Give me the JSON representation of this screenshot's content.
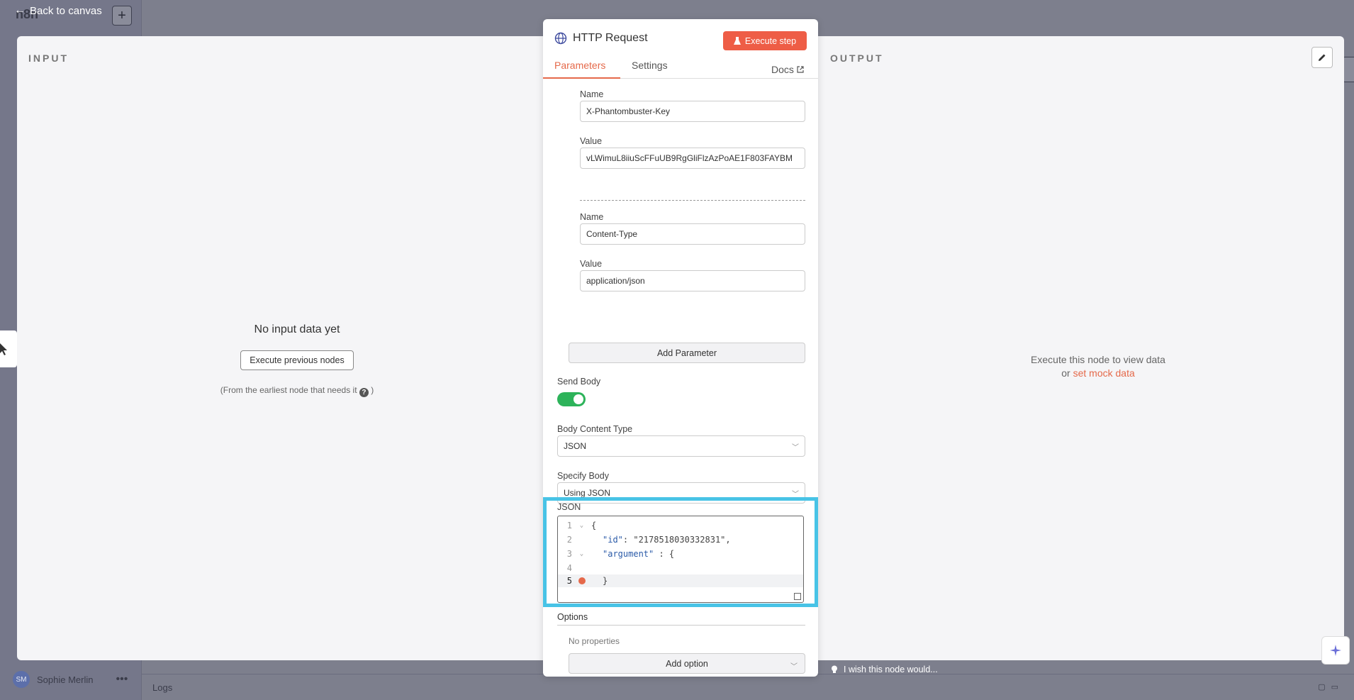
{
  "background": {
    "app_logo": "n8n",
    "user_initials": "SM",
    "user_name": "Sophie Merlin",
    "logs_label": "Logs"
  },
  "back_to_canvas": "Back to canvas",
  "input_pane": {
    "title": "INPUT",
    "empty_heading": "No input data yet",
    "execute_previous_label": "Execute previous nodes",
    "hint_prefix": "(From the earliest node that needs it",
    "hint_suffix": ")"
  },
  "output_pane": {
    "title": "OUTPUT",
    "message_line1": "Execute this node to view data",
    "message_or": "or",
    "mock_link": "set mock data"
  },
  "node": {
    "title": "HTTP Request",
    "execute_label": "Execute step",
    "tabs": {
      "parameters": "Parameters",
      "settings": "Settings",
      "docs": "Docs"
    },
    "headers": [
      {
        "name_label": "Name",
        "name_value": "X-Phantombuster-Key",
        "value_label": "Value",
        "value_value": "vLWimuL8iiuScFFuUB9RgGliFlzAzPoAE1F803FAYBM"
      },
      {
        "name_label": "Name",
        "name_value": "Content-Type",
        "value_label": "Value",
        "value_value": "application/json"
      }
    ],
    "add_parameter": "Add Parameter",
    "send_body_label": "Send Body",
    "send_body_on": true,
    "body_content_type_label": "Body Content Type",
    "body_content_type_value": "JSON",
    "specify_body_label": "Specify Body",
    "specify_body_value": "Using JSON",
    "json_label": "JSON",
    "json_lines": [
      {
        "num": "1",
        "text": "{"
      },
      {
        "num": "2",
        "key": "\"id\"",
        "rest": ": \"2178518030332831\","
      },
      {
        "num": "3",
        "key": "\"argument\"",
        "rest": " : {"
      },
      {
        "num": "4",
        "text": ""
      },
      {
        "num": "5",
        "text": "}"
      }
    ],
    "options_label": "Options",
    "no_properties": "No properties",
    "add_option": "Add option"
  },
  "wish_text": "I wish this node would...",
  "colors": {
    "accent": "#ee5d46",
    "toggle_on": "#2db35a",
    "highlight_border": "#48c3e6",
    "json_key": "#2b5ba8"
  }
}
